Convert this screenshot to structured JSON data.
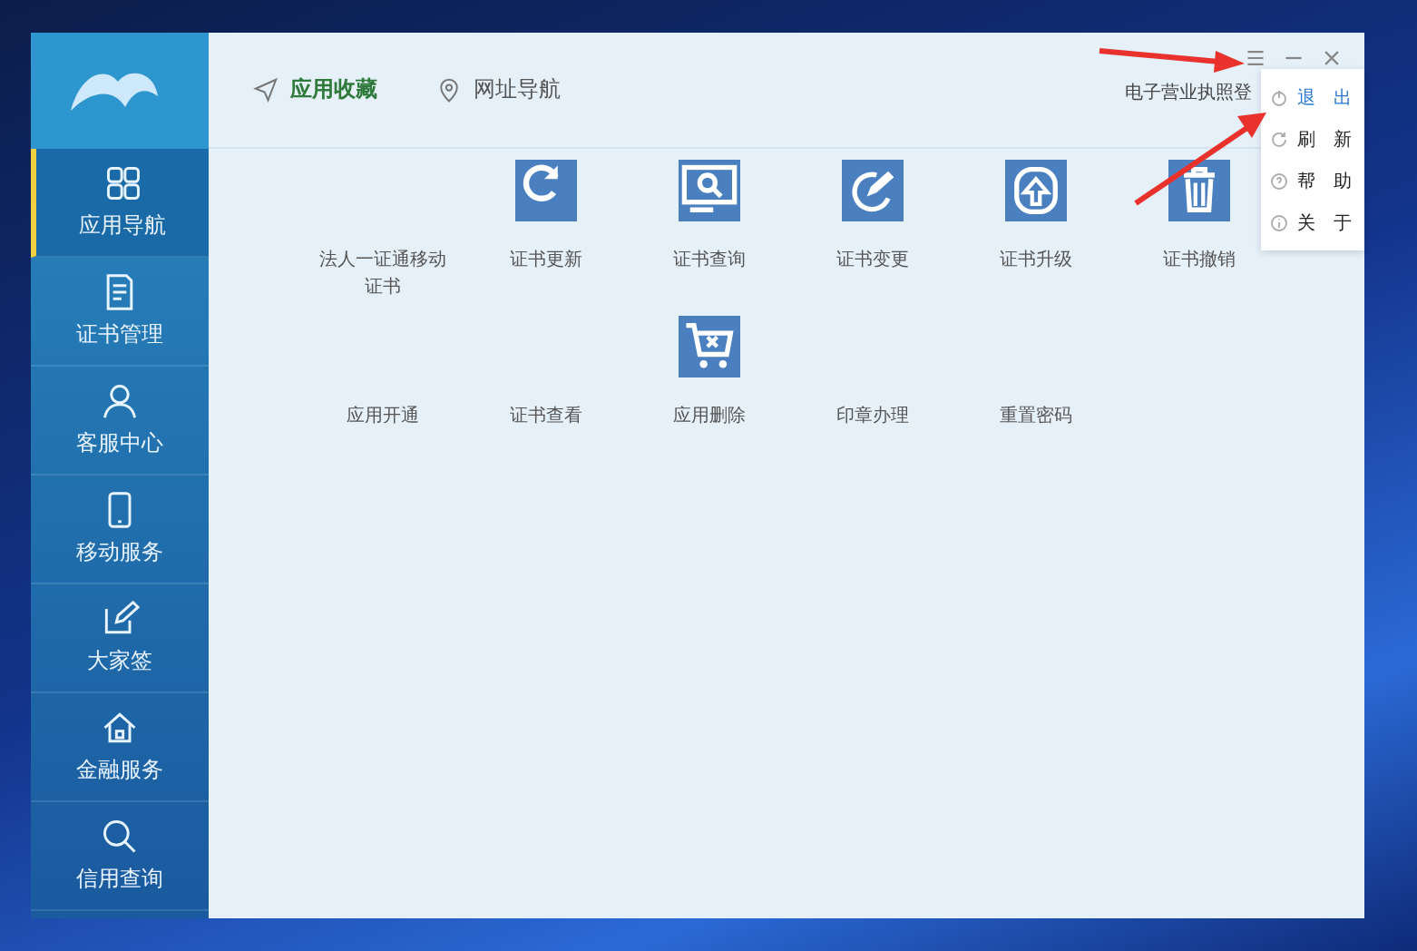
{
  "sidebar": {
    "items": [
      {
        "label": "应用导航",
        "kind": "grid",
        "selected": true
      },
      {
        "label": "证书管理",
        "kind": "document",
        "selected": false
      },
      {
        "label": "客服中心",
        "kind": "person",
        "selected": false
      },
      {
        "label": "移动服务",
        "kind": "phone",
        "selected": false
      },
      {
        "label": "大家签",
        "kind": "edit",
        "selected": false
      },
      {
        "label": "金融服务",
        "kind": "house",
        "selected": false
      },
      {
        "label": "信用查询",
        "kind": "search",
        "selected": false
      }
    ]
  },
  "tabs": [
    {
      "label": "应用收藏",
      "kind": "send",
      "selected": true
    },
    {
      "label": "网址导航",
      "kind": "pin",
      "selected": false
    }
  ],
  "header_text": "电子营业执照登",
  "window_controls": [
    {
      "kind": "menu"
    },
    {
      "kind": "minimize"
    },
    {
      "kind": "close"
    }
  ],
  "menu": {
    "items": [
      {
        "label": "退　出",
        "kind": "power",
        "selected": true
      },
      {
        "label": "刷　新",
        "kind": "refresh",
        "selected": false
      },
      {
        "label": "帮　助",
        "kind": "help",
        "selected": false
      },
      {
        "label": "关　于",
        "kind": "info",
        "selected": false
      }
    ]
  },
  "apps": [
    [
      {
        "label": "法人一证通移动证书",
        "kind": "plain"
      },
      {
        "label": "证书更新",
        "kind": "refresh"
      },
      {
        "label": "证书查询",
        "kind": "search"
      },
      {
        "label": "证书变更",
        "kind": "change"
      },
      {
        "label": "证书升级",
        "kind": "upgrade"
      },
      {
        "label": "证书撤销",
        "kind": "trash"
      }
    ],
    [
      {
        "label": "应用开通",
        "kind": "plain"
      },
      {
        "label": "证书查看",
        "kind": "plain"
      },
      {
        "label": "应用删除",
        "kind": "cart"
      },
      {
        "label": "印章办理",
        "kind": "plain"
      },
      {
        "label": "重置密码",
        "kind": "plain"
      }
    ]
  ]
}
